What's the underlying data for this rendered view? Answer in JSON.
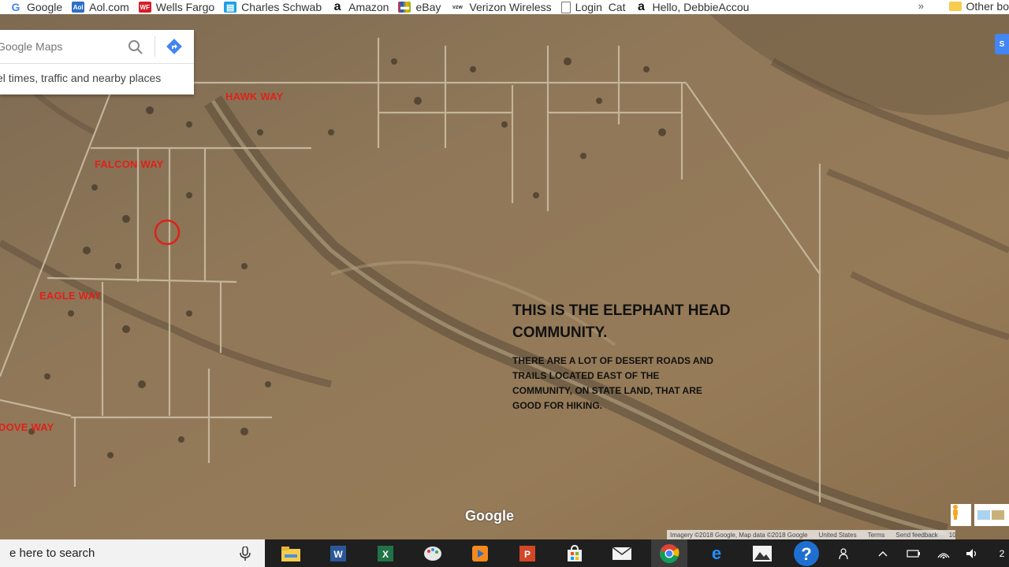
{
  "bookmarks": {
    "items": [
      {
        "label": "Google",
        "icon": "google-g-icon",
        "color": "#4285f4"
      },
      {
        "label": "Aol.com",
        "icon": "aol-icon",
        "color": "#2f6fc6"
      },
      {
        "label": "Wells Fargo",
        "icon": "wells-fargo-icon",
        "color": "#d71e28"
      },
      {
        "label": "Charles Schwab",
        "icon": "schwab-icon",
        "color": "#1da1e2"
      },
      {
        "label": "Amazon",
        "icon": "amazon-icon",
        "color": "#111111"
      },
      {
        "label": "eBay",
        "icon": "ebay-icon",
        "color": "#e53238"
      },
      {
        "label": "Verizon Wireless",
        "icon": "verizon-icon",
        "color": "#333333"
      },
      {
        "label": "Login  Cat",
        "icon": "page-icon",
        "color": "#777777"
      },
      {
        "label": "Hello, DebbieAccou",
        "icon": "amazon-icon",
        "color": "#111111"
      }
    ],
    "more": "»",
    "other": "Other bo"
  },
  "maps": {
    "search_placeholder": "Google Maps",
    "hint": "el times, traffic and nearby places",
    "logo": "Google",
    "attribution": [
      "Imagery ©2018 Google, Map data ©2018 Google",
      "United States",
      "Terms",
      "Send feedback",
      "1000 ft"
    ],
    "signin": "S"
  },
  "streets": [
    "HAWK WAY",
    "FALCON WAY",
    "EAGLE WAY",
    "DOVE WAY"
  ],
  "annotation": {
    "title": "THIS IS THE ELEPHANT HEAD COMMUNITY.",
    "body": "THERE ARE A LOT OF DESERT ROADS AND TRAILS LOCATED EAST OF THE COMMUNITY, ON STATE LAND, THAT ARE GOOD FOR HIKING."
  },
  "taskbar": {
    "search_text": "e here to search",
    "apps": [
      "file-explorer-icon",
      "word-icon",
      "excel-icon",
      "paint-icon",
      "media-player-icon",
      "powerpoint-icon",
      "store-icon",
      "mail-icon",
      "chrome-icon",
      "edge-icon",
      "photos-icon",
      "help-icon"
    ],
    "tray_time": "2"
  }
}
